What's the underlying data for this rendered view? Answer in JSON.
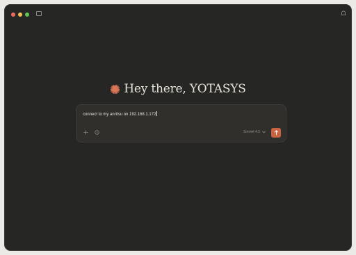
{
  "window": {
    "traffic_lights": {
      "close_color": "#ed6a5e",
      "minimize_color": "#f4bf4f",
      "zoom_color": "#61c554"
    },
    "icons": {
      "sidebar_toggle": "sidebar-toggle-icon",
      "top_right": "notification-icon"
    }
  },
  "greeting": {
    "icon": "sparkle-icon",
    "accent_color": "#d97757",
    "text": "Hey there, YOTASYS"
  },
  "composer": {
    "input_value": "connect to my anritsu on 192.168.1.172",
    "add_icon": "plus-icon",
    "tools_icon": "clock-icon",
    "model_label": "Sonnet 4.5",
    "model_chevron_icon": "chevron-down-icon",
    "send_icon": "arrow-up-icon",
    "send_color": "#c96442"
  }
}
